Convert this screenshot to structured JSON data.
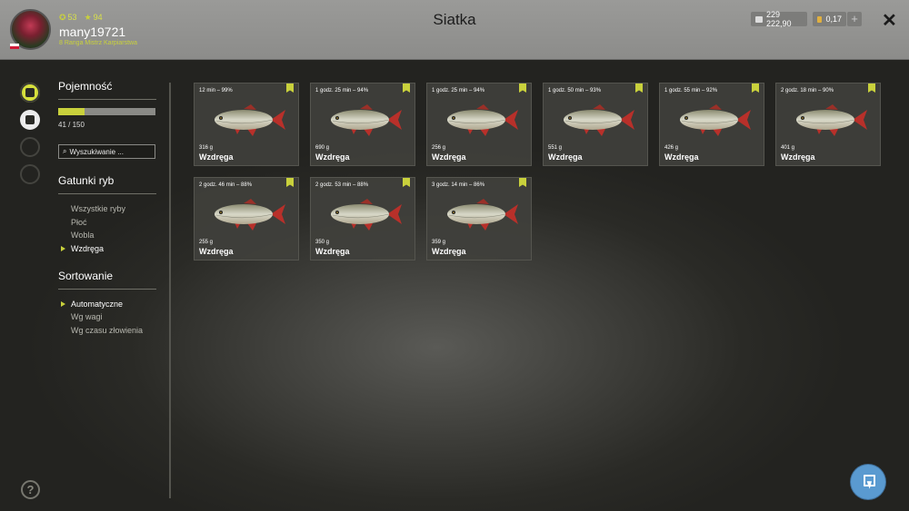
{
  "header": {
    "title": "Siatka",
    "player": {
      "level": "53",
      "stars": "94",
      "username": "many19721",
      "rank": "8 Ranga Mistrz Karpiarstwa"
    },
    "currency": {
      "silver": "229 222,90",
      "gold": "0,17",
      "plus": "+"
    },
    "close": "✕"
  },
  "panel": {
    "capacity_title": "Pojemność",
    "capacity_text": "41 / 150",
    "capacity_fraction": 0.2733,
    "search_placeholder": "Wyszukiwanie ...",
    "species_title": "Gatunki ryb",
    "species": [
      {
        "label": "Wszystkie ryby",
        "active": false
      },
      {
        "label": "Płoć",
        "active": false
      },
      {
        "label": "Wobla",
        "active": false
      },
      {
        "label": "Wzdręga",
        "active": true
      }
    ],
    "sort_title": "Sortowanie",
    "sort": [
      {
        "label": "Automatyczne",
        "active": true
      },
      {
        "label": "Wg wagi",
        "active": false
      },
      {
        "label": "Wg czasu złowienia",
        "active": false
      }
    ]
  },
  "fish": [
    {
      "meta": "12 min – 99%",
      "weight": "316 g",
      "name": "Wzdręga"
    },
    {
      "meta": "1 godz. 25 min – 94%",
      "weight": "690 g",
      "name": "Wzdręga"
    },
    {
      "meta": "1 godz. 25 min – 94%",
      "weight": "256 g",
      "name": "Wzdręga"
    },
    {
      "meta": "1 godz. 50 min – 93%",
      "weight": "551 g",
      "name": "Wzdręga"
    },
    {
      "meta": "1 godz. 55 min – 92%",
      "weight": "426 g",
      "name": "Wzdręga"
    },
    {
      "meta": "2 godz. 18 min – 90%",
      "weight": "401 g",
      "name": "Wzdręga"
    },
    {
      "meta": "2 godz. 46 min – 88%",
      "weight": "255 g",
      "name": "Wzdręga"
    },
    {
      "meta": "2 godz. 53 min – 88%",
      "weight": "350 g",
      "name": "Wzdręga"
    },
    {
      "meta": "3 godz. 14 min – 86%",
      "weight": "359 g",
      "name": "Wzdręga"
    }
  ],
  "icons": {
    "rail": [
      "fish-net-icon",
      "keepnet-icon",
      "cooler-icon",
      "home-icon"
    ],
    "help": "?",
    "cursor": "cursor-icon"
  },
  "colors": {
    "accent": "#c9d13c",
    "cursor_button": "#5a9ad0"
  }
}
